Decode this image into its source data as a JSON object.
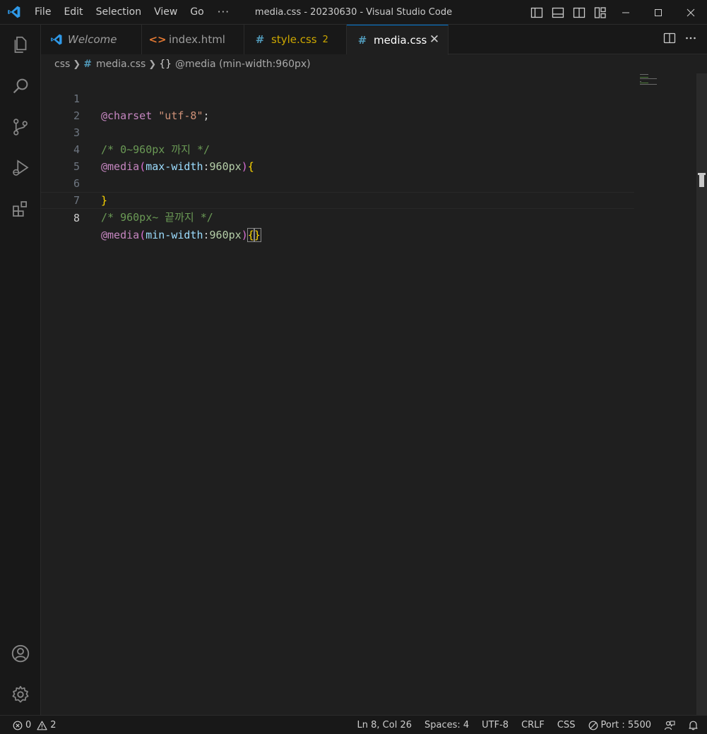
{
  "window": {
    "title": "media.css - 20230630 - Visual Studio Code"
  },
  "menu": {
    "items": [
      "File",
      "Edit",
      "Selection",
      "View",
      "Go"
    ],
    "more": "···"
  },
  "tabs": [
    {
      "label": "Welcome",
      "icon": "vscode-icon",
      "italic": true
    },
    {
      "label": "index.html",
      "icon": "html-icon"
    },
    {
      "label": "style.css",
      "icon": "hash-icon",
      "badge": "2",
      "color": "#cca700"
    },
    {
      "label": "media.css",
      "icon": "hash-icon",
      "active": true,
      "close": "✕"
    }
  ],
  "breadcrumb": {
    "folder": "css",
    "file": "media.css",
    "symbol_icon": "{}",
    "symbol": "@media (min-width:960px)"
  },
  "editor": {
    "active_line": 8,
    "line_numbers": [
      "1",
      "2",
      "3",
      "4",
      "5",
      "6",
      "7",
      "8"
    ],
    "lines": {
      "l1": {
        "at": "@charset",
        "space": " ",
        "str": "\"utf-8\"",
        "semi": ";"
      },
      "l3": {
        "comment": "/* 0~960px 까지 */"
      },
      "l4": {
        "at": "@media",
        "open": "(",
        "prop": "max-width",
        "colon": ":",
        "num": "960px",
        "close": ")",
        "brace": "{"
      },
      "l6": {
        "brace": "}"
      },
      "l7": {
        "comment": "/* 960px~ 끝까지 */"
      },
      "l8": {
        "at": "@media",
        "open": "(",
        "prop": "min-width",
        "colon": ":",
        "num": "960px",
        "close": ")",
        "brace_open": "{",
        "brace_close": "}"
      }
    }
  },
  "statusbar": {
    "errors": "0",
    "warnings": "2",
    "position": "Ln 8, Col 26",
    "spaces": "Spaces: 4",
    "encoding": "UTF-8",
    "eol": "CRLF",
    "language": "CSS",
    "port": "Port : 5500"
  },
  "colors": {
    "accent": "#0078d4",
    "warning": "#cca700",
    "css_icon": "#519aba",
    "html_icon": "#e37933"
  }
}
